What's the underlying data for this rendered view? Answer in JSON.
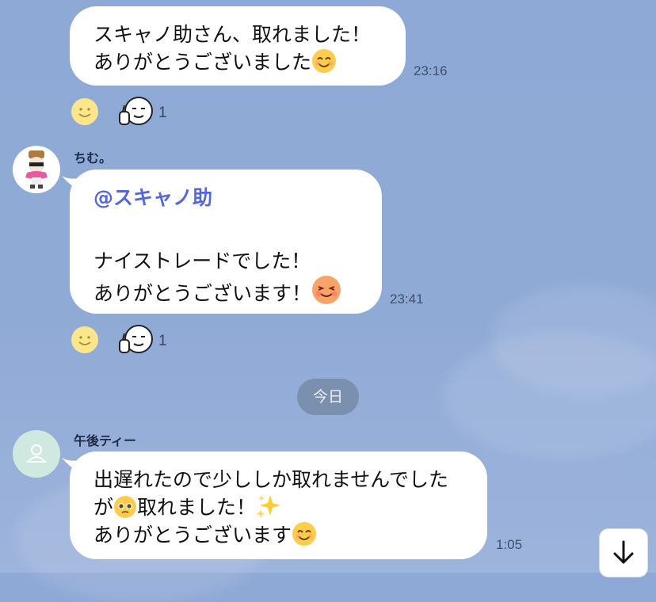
{
  "messages": [
    {
      "lines": [
        "スキャノ助さん、取れました！",
        "ありがとうございました"
      ],
      "time": "23:16",
      "reaction_count": "1"
    },
    {
      "sender": "ちむ。",
      "mention": "@スキャノ助",
      "lines": [
        "ナイストレードでした！",
        "ありがとうございます！"
      ],
      "time": "23:41",
      "reaction_count": "1"
    },
    {
      "sender": "午後ティー",
      "lines": [
        "出遅れたので少ししか取れませんでした",
        "が",
        "取れました！",
        "ありがとうございます"
      ],
      "time": "1:05"
    }
  ],
  "date_separator": "今日",
  "colors": {
    "background": "#90aad6",
    "bubble": "#ffffff",
    "mention": "#5468d6",
    "date_pill": "#7b8faf"
  },
  "icons": [
    "smile-reaction-icon",
    "thumbs-up-face-reaction-icon",
    "default-user-avatar-icon",
    "scroll-down-arrow-icon"
  ]
}
